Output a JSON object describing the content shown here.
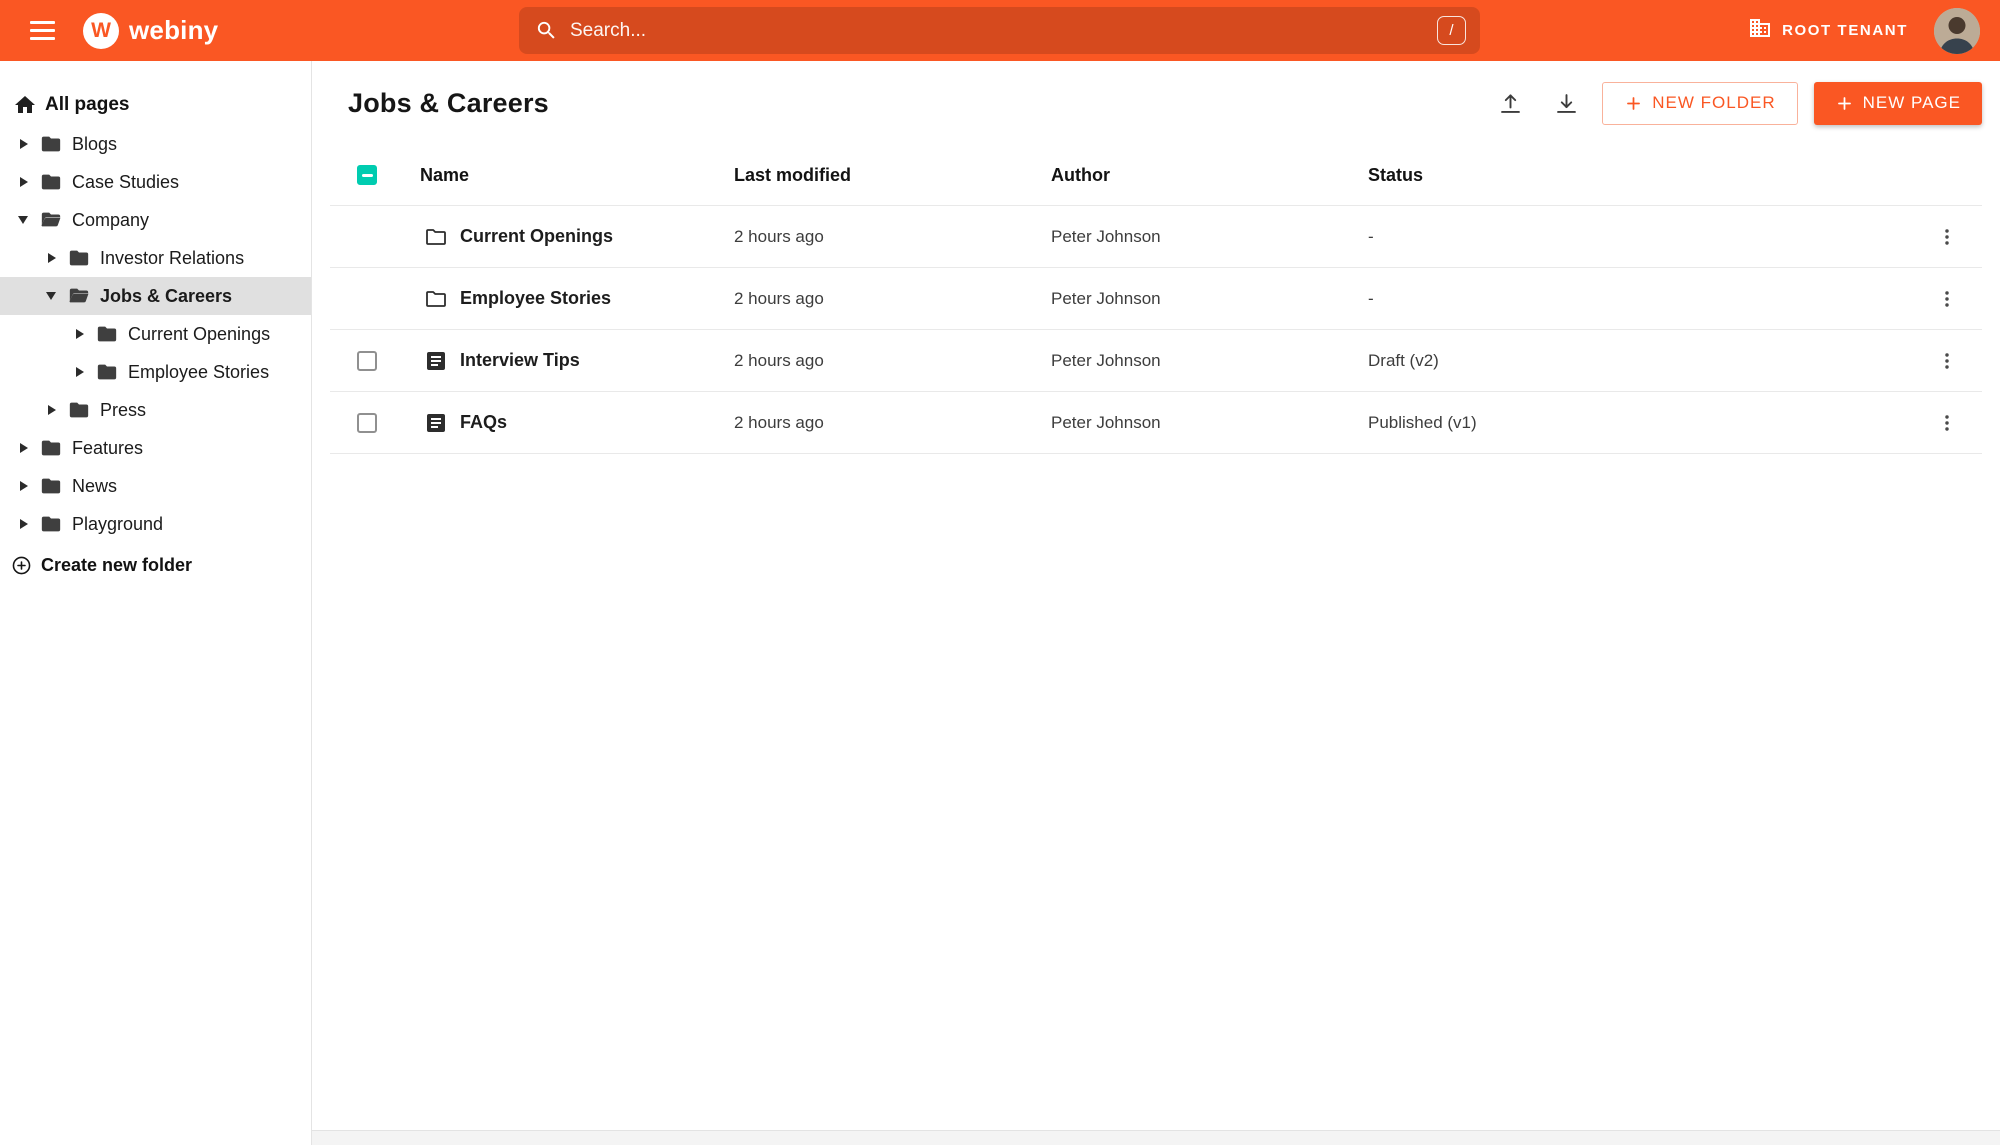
{
  "colors": {
    "accent": "#fa5723",
    "selection_gray": "#e0e0e0",
    "checkbox_teal": "#00ccb0"
  },
  "topbar": {
    "logo_letter": "W",
    "logo_text": "webiny",
    "search_placeholder": "Search...",
    "search_shortcut": "/",
    "tenant_label": "ROOT TENANT"
  },
  "sidebar": {
    "root_label": "All pages",
    "create_folder_label": "Create new folder",
    "items": [
      {
        "label": "Blogs",
        "level": 0,
        "expanded": false,
        "selected": false
      },
      {
        "label": "Case Studies",
        "level": 0,
        "expanded": false,
        "selected": false
      },
      {
        "label": "Company",
        "level": 0,
        "expanded": true,
        "selected": false
      },
      {
        "label": "Investor Relations",
        "level": 1,
        "expanded": false,
        "selected": false
      },
      {
        "label": "Jobs & Careers",
        "level": 1,
        "expanded": true,
        "selected": true
      },
      {
        "label": "Current Openings",
        "level": 2,
        "expanded": false,
        "selected": false
      },
      {
        "label": "Employee Stories",
        "level": 2,
        "expanded": false,
        "selected": false
      },
      {
        "label": "Press",
        "level": 1,
        "expanded": false,
        "selected": false
      },
      {
        "label": "Features",
        "level": 0,
        "expanded": false,
        "selected": false
      },
      {
        "label": "News",
        "level": 0,
        "expanded": false,
        "selected": false
      },
      {
        "label": "Playground",
        "level": 0,
        "expanded": false,
        "selected": false
      }
    ]
  },
  "content": {
    "title": "Jobs & Careers",
    "new_folder_label": "NEW FOLDER",
    "new_page_label": "NEW PAGE",
    "table": {
      "columns": {
        "name": "Name",
        "modified": "Last modified",
        "author": "Author",
        "status": "Status"
      },
      "rows": [
        {
          "type": "folder",
          "name": "Current Openings",
          "modified": "2 hours ago",
          "author": "Peter Johnson",
          "status": "-",
          "has_checkbox": false
        },
        {
          "type": "folder",
          "name": "Employee Stories",
          "modified": "2 hours ago",
          "author": "Peter Johnson",
          "status": "-",
          "has_checkbox": false
        },
        {
          "type": "page",
          "name": "Interview Tips",
          "modified": "2 hours ago",
          "author": "Peter Johnson",
          "status": "Draft (v2)",
          "has_checkbox": true
        },
        {
          "type": "page",
          "name": "FAQs",
          "modified": "2 hours ago",
          "author": "Peter Johnson",
          "status": "Published (v1)",
          "has_checkbox": true
        }
      ]
    }
  }
}
